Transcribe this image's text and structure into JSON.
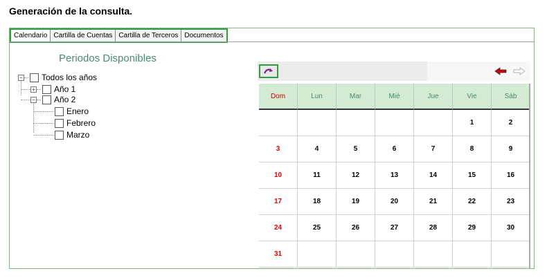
{
  "page_title": "Generación de la consulta.",
  "tabs": [
    {
      "label": "Calendario",
      "active": true
    },
    {
      "label": "Cartilla de Cuentas",
      "active": false
    },
    {
      "label": "Cartilla de Terceros",
      "active": false
    },
    {
      "label": "Documentos",
      "active": false
    }
  ],
  "periods": {
    "title": "Periodos Disponibles",
    "tree": {
      "root": "Todos los años",
      "year1": "Año 1",
      "year2": "Año 2",
      "months": [
        "Enero",
        "Febrero",
        "Marzo"
      ]
    }
  },
  "calendar": {
    "weekdays": [
      "Dom",
      "Lun",
      "Mar",
      "Mié",
      "Jue",
      "Vie",
      "Sáb"
    ],
    "weeks": [
      [
        "",
        "",
        "",
        "",
        "",
        "1",
        "2"
      ],
      [
        "3",
        "4",
        "5",
        "6",
        "7",
        "8",
        "9"
      ],
      [
        "10",
        "11",
        "12",
        "13",
        "14",
        "15",
        "16"
      ],
      [
        "17",
        "18",
        "19",
        "20",
        "21",
        "22",
        "23"
      ],
      [
        "24",
        "25",
        "26",
        "27",
        "28",
        "29",
        "30"
      ],
      [
        "31",
        "",
        "",
        "",
        "",
        "",
        ""
      ]
    ],
    "icons": {
      "refresh": "refresh-icon",
      "prev": "arrow-left-icon",
      "next": "arrow-right-icon"
    },
    "colors": {
      "sunday": "#e00000",
      "header_bg": "#d3ead3",
      "prev_arrow": "#c00000"
    }
  }
}
